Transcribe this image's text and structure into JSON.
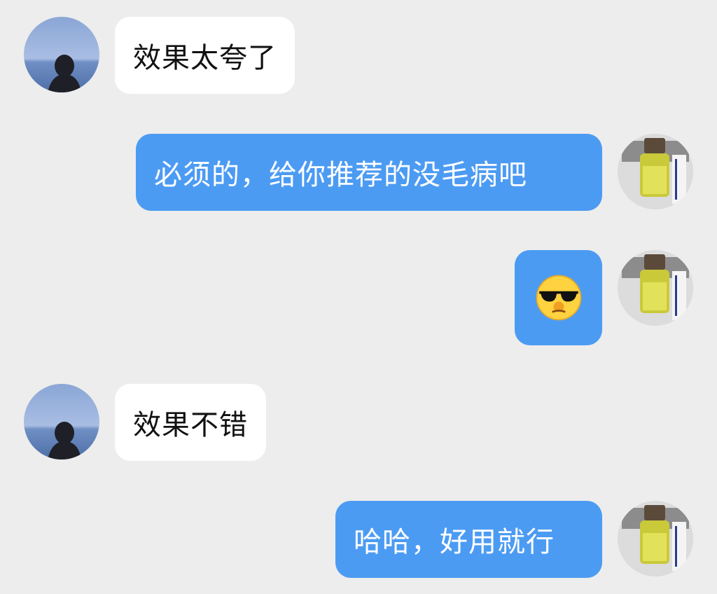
{
  "colors": {
    "background": "#ededed",
    "incoming_bubble": "#ffffff",
    "outgoing_bubble": "#4c9bf3",
    "incoming_text": "#111111",
    "outgoing_text": "#ffffff"
  },
  "messages": [
    {
      "sender": "other",
      "text": "效果太夸了"
    },
    {
      "sender": "me",
      "text": "必须的，给你推荐的没毛病吧"
    },
    {
      "sender": "me",
      "sticker": "cool-sunglasses-smirk-emoji"
    },
    {
      "sender": "other",
      "text": "效果不错"
    },
    {
      "sender": "me",
      "text": "哈哈，好用就行"
    }
  ],
  "avatars": {
    "other": "ocean-silhouette-avatar",
    "me": "oil-bottle-product-avatar"
  }
}
